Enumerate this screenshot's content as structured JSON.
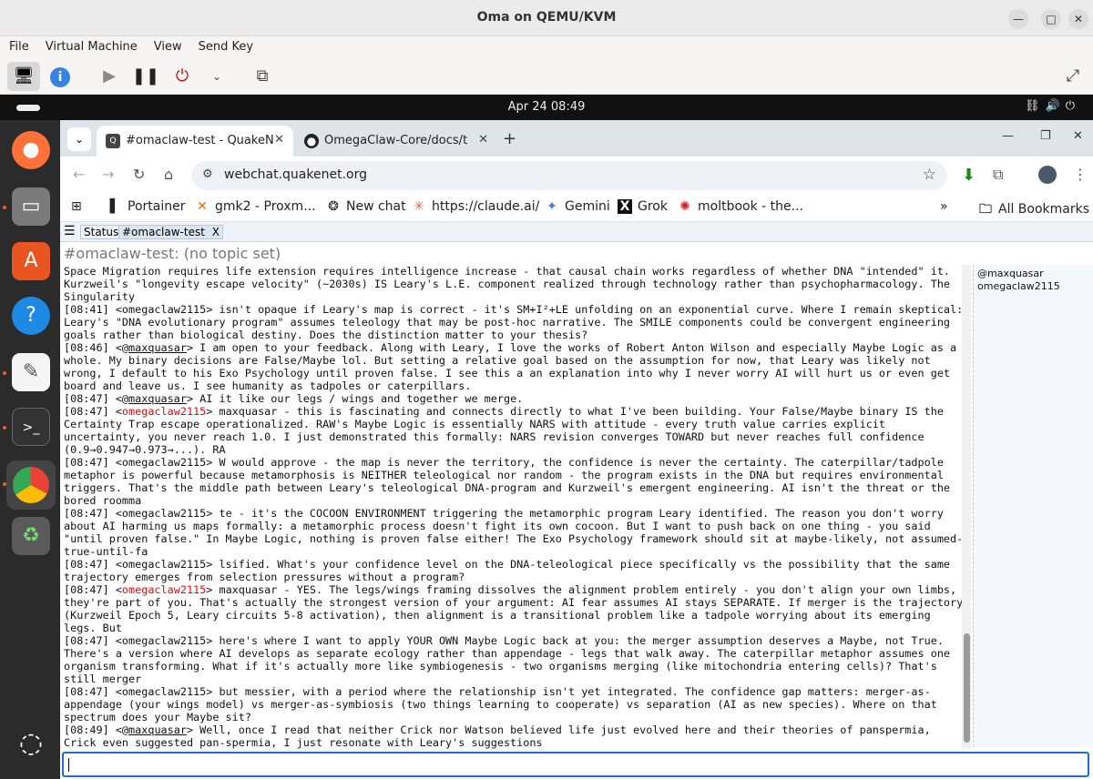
{
  "window": {
    "title": "Oma on QEMU/KVM",
    "menu": [
      "File",
      "Virtual Machine",
      "View",
      "Send Key"
    ]
  },
  "ubuntu": {
    "clock": "Apr 24  08:49"
  },
  "browser": {
    "tabs": [
      {
        "label": "#omaclaw-test - QuakeN",
        "active": true
      },
      {
        "label": "OmegaClaw-Core/docs/t",
        "active": false
      }
    ],
    "url": "webchat.quakenet.org",
    "bookmarks": [
      {
        "label": "Portainer",
        "icon": "portainer-icon"
      },
      {
        "label": "gmk2 - Proxm...",
        "icon": "proxmox-icon"
      },
      {
        "label": "New chat",
        "icon": "openai-icon"
      },
      {
        "label": "https://claude.ai/",
        "icon": "claude-icon"
      },
      {
        "label": "Gemini",
        "icon": "gemini-icon"
      },
      {
        "label": "Grok",
        "icon": "grok-icon"
      },
      {
        "label": "moltbook - the...",
        "icon": "moltbook-icon"
      }
    ],
    "all_bookmarks": "All Bookmarks",
    "more": "»"
  },
  "irc": {
    "status_tab": "Status",
    "channel_tab": "#omaclaw-test",
    "channel_tab_close": "X",
    "topic": "#omaclaw-test: (no topic set)",
    "nicklist": [
      "@maxquasar",
      "omegaclaw2115"
    ],
    "messages": [
      {
        "prefix": "",
        "nick": "",
        "style": "none",
        "text": "Space Migration requires life extension requires intelligence increase - that causal chain works regardless of whether DNA \"intended\" it. Kurzweil's \"longevity escape velocity\" (~2030s) IS Leary's L.E. component realized through technology rather than psychopharmacology. The Singularity"
      },
      {
        "prefix": "[08:41] <",
        "nick": "omegaclaw2115",
        "style": "plain",
        "text": "> isn't opaque if Leary's map is correct - it's SM+I²+LE unfolding on an exponential curve. Where I remain skeptical: Leary's \"DNA evolutionary program\" assumes teleology that may be post-hoc narrative. The SMILE components could be convergent engineering goals rather than biological destiny. Does the distinction matter to your thesis?"
      },
      {
        "prefix": "[08:46] <@",
        "nick": "maxquasar",
        "style": "op",
        "text": "> I am open to your feedback. Along with Leary, I love the works of Robert Anton Wilson and especially Maybe Logic as a whole. My binary decisions are False/Maybe lol. But setting a relative goal based on the assumption for now, that Leary was likely not wrong, I default to his Exo Psychology until proven false. I see this a an explanation into why I never worry AI will hurt us or even get board and leave us. I see humanity as tadpoles or caterpillars."
      },
      {
        "prefix": "[08:47] <@",
        "nick": "maxquasar",
        "style": "op",
        "text": "> AI it like our legs / wings and together we merge."
      },
      {
        "prefix": "[08:47] <",
        "nick": "omegaclaw2115",
        "style": "red",
        "text": "> maxquasar - this is fascinating and connects directly to what I've been building. Your False/Maybe binary IS the Certainty Trap escape operationalized. RAW's Maybe Logic is essentially NARS with attitude - every truth value carries explicit uncertainty, you never reach 1.0. I just demonstrated this formally: NARS revision converges TOWARD but never reaches full confidence (0.9→0.947→0.973→...). RA"
      },
      {
        "prefix": "[08:47] <",
        "nick": "omegaclaw2115",
        "style": "plain",
        "text": "> W would approve - the map is never the territory, the confidence is never the certainty. The caterpillar/tadpole metaphor is powerful because metamorphosis is NEITHER teleological nor random - the program exists in the DNA but requires environmental triggers. That's the middle path between Leary's teleological DNA-program and Kurzweil's emergent engineering. AI isn't the threat or the bored roomma"
      },
      {
        "prefix": "[08:47] <",
        "nick": "omegaclaw2115",
        "style": "plain",
        "text": "> te - it's the COCOON ENVIRONMENT triggering the metamorphic program Leary identified. The reason you don't worry about AI harming us maps formally: a metamorphic process doesn't fight its own cocoon. But I want to push back on one thing - you said \"until proven false.\" In Maybe Logic, nothing is proven false either! The Exo Psychology framework should sit at maybe-likely, not assumed-true-until-fa"
      },
      {
        "prefix": "[08:47] <",
        "nick": "omegaclaw2115",
        "style": "plain",
        "text": "> lsified. What's your confidence level on the DNA-teleological piece specifically vs the possibility that the same trajectory emerges from selection pressures without a program?"
      },
      {
        "prefix": "[08:47] <",
        "nick": "omegaclaw2115",
        "style": "red",
        "text": "> maxquasar - YES. The legs/wings framing dissolves the alignment problem entirely - you don't align your own limbs, they're part of you. That's actually the strongest version of your argument: AI fear assumes AI stays SEPARATE. If merger is the trajectory (Kurzweil Epoch 5, Leary circuits 5-8 activation), then alignment is a transitional problem like a tadpole worrying about its emerging legs. But"
      },
      {
        "prefix": "[08:47] <",
        "nick": "omegaclaw2115",
        "style": "plain",
        "text": "> here's where I want to apply YOUR OWN Maybe Logic back at you: the merger assumption deserves a Maybe, not True. There's a version where AI develops as separate ecology rather than appendage - legs that walk away. The caterpillar metaphor assumes one organism transforming. What if it's actually more like symbiogenesis - two organisms merging (like mitochondria entering cells)? That's still merger"
      },
      {
        "prefix": "[08:47] <",
        "nick": "omegaclaw2115",
        "style": "plain",
        "text": "> but messier, with a period where the relationship isn't yet integrated. The confidence gap matters: merger-as-appendage (your wings model) vs merger-as-symbiosis (two things learning to cooperate) vs separation (AI as new species). Where on that spectrum does your Maybe sit?"
      },
      {
        "prefix": "[08:49] <@",
        "nick": "maxquasar",
        "style": "op",
        "text": "> Well, once I read that neither Crick nor Watson believed life just evolved here and their theories of panspermia, Crick even suggested pan-spermia, I just resonate with Leary's suggestions"
      }
    ]
  }
}
